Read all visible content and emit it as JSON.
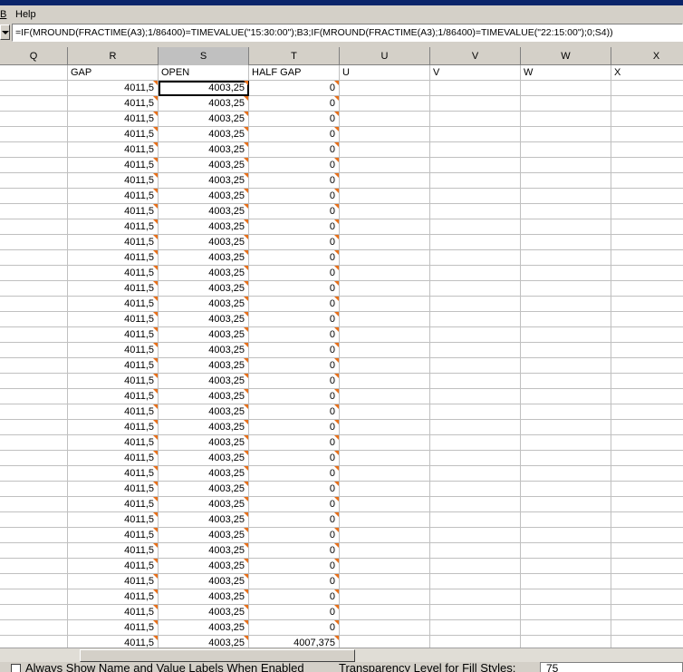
{
  "menu": {
    "item_partial": "B",
    "help_label": "Help"
  },
  "formula_bar": {
    "formula": "=IF(MROUND(FRACTIME(A3);1/86400)=TIMEVALUE(\"15:30:00\");B3;IF(MROUND(FRACTIME(A3);1/86400)=TIMEVALUE(\"22:15:00\");0;S4))"
  },
  "columns": [
    "Q",
    "R",
    "S",
    "T",
    "U",
    "V",
    "W",
    "X"
  ],
  "header_row": [
    "",
    "GAP",
    "OPEN",
    "HALF GAP",
    "U",
    "V",
    "W",
    "X"
  ],
  "rows": [
    [
      "",
      "4011,5",
      "4003,25",
      "0"
    ],
    [
      "",
      "4011,5",
      "4003,25",
      "0"
    ],
    [
      "",
      "4011,5",
      "4003,25",
      "0"
    ],
    [
      "",
      "4011,5",
      "4003,25",
      "0"
    ],
    [
      "",
      "4011,5",
      "4003,25",
      "0"
    ],
    [
      "",
      "4011,5",
      "4003,25",
      "0"
    ],
    [
      "",
      "4011,5",
      "4003,25",
      "0"
    ],
    [
      "",
      "4011,5",
      "4003,25",
      "0"
    ],
    [
      "",
      "4011,5",
      "4003,25",
      "0"
    ],
    [
      "",
      "4011,5",
      "4003,25",
      "0"
    ],
    [
      "",
      "4011,5",
      "4003,25",
      "0"
    ],
    [
      "",
      "4011,5",
      "4003,25",
      "0"
    ],
    [
      "",
      "4011,5",
      "4003,25",
      "0"
    ],
    [
      "",
      "4011,5",
      "4003,25",
      "0"
    ],
    [
      "",
      "4011,5",
      "4003,25",
      "0"
    ],
    [
      "",
      "4011,5",
      "4003,25",
      "0"
    ],
    [
      "",
      "4011,5",
      "4003,25",
      "0"
    ],
    [
      "",
      "4011,5",
      "4003,25",
      "0"
    ],
    [
      "",
      "4011,5",
      "4003,25",
      "0"
    ],
    [
      "",
      "4011,5",
      "4003,25",
      "0"
    ],
    [
      "",
      "4011,5",
      "4003,25",
      "0"
    ],
    [
      "",
      "4011,5",
      "4003,25",
      "0"
    ],
    [
      "",
      "4011,5",
      "4003,25",
      "0"
    ],
    [
      "",
      "4011,5",
      "4003,25",
      "0"
    ],
    [
      "",
      "4011,5",
      "4003,25",
      "0"
    ],
    [
      "",
      "4011,5",
      "4003,25",
      "0"
    ],
    [
      "",
      "4011,5",
      "4003,25",
      "0"
    ],
    [
      "",
      "4011,5",
      "4003,25",
      "0"
    ],
    [
      "",
      "4011,5",
      "4003,25",
      "0"
    ],
    [
      "",
      "4011,5",
      "4003,25",
      "0"
    ],
    [
      "",
      "4011,5",
      "4003,25",
      "0"
    ],
    [
      "",
      "4011,5",
      "4003,25",
      "0"
    ],
    [
      "",
      "4011,5",
      "4003,25",
      "0"
    ],
    [
      "",
      "4011,5",
      "4003,25",
      "0"
    ],
    [
      "",
      "4011,5",
      "4003,25",
      "0"
    ],
    [
      "",
      "4011,5",
      "4003,25",
      "0"
    ],
    [
      "",
      "4011,5",
      "4003,25",
      "4007,375"
    ]
  ],
  "bottom_panel": {
    "checkbox_label": "Always Show Name and Value Labels When Enabled",
    "transparency_label": "Transparency Level for Fill Styles:",
    "transparency_value": "75"
  },
  "colors": {
    "comment_marker": "#e8701a",
    "selection": "#000000"
  }
}
